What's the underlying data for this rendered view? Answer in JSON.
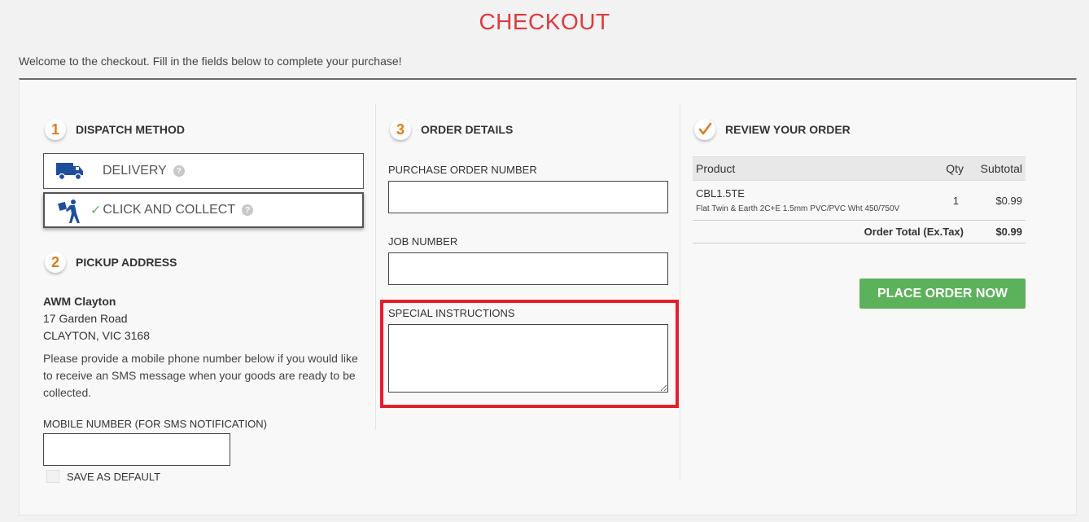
{
  "header": {
    "title": "CHECKOUT",
    "welcome": "Welcome to the checkout. Fill in the fields below to complete your purchase!"
  },
  "dispatch": {
    "step_number": "1",
    "title": "DISPATCH METHOD",
    "options": [
      {
        "label": "DELIVERY",
        "icon": "truck-icon",
        "selected": false
      },
      {
        "label": "CLICK AND COLLECT",
        "icon": "person-carrying-box-icon",
        "selected": true
      }
    ]
  },
  "pickup": {
    "step_number": "2",
    "title": "PICKUP ADDRESS",
    "name": "AWM Clayton",
    "street": "17 Garden Road",
    "city": "CLAYTON, VIC 3168",
    "sms_note": "Please provide a mobile phone number below if you would like to receive an SMS message when your goods are ready to be collected.",
    "mobile_label": "MOBILE NUMBER (FOR SMS NOTIFICATION)",
    "mobile_value": "",
    "save_default_label": "SAVE AS DEFAULT"
  },
  "order_details": {
    "step_number": "3",
    "title": "ORDER DETAILS",
    "po_label": "PURCHASE ORDER NUMBER",
    "po_value": "",
    "job_label": "JOB NUMBER",
    "job_value": "",
    "instructions_label": "SPECIAL INSTRUCTIONS",
    "instructions_value": ""
  },
  "review": {
    "title": "REVIEW YOUR ORDER",
    "headers": {
      "product": "Product",
      "qty": "Qty",
      "subtotal": "Subtotal"
    },
    "items": [
      {
        "code": "CBL1.5TE",
        "description": "Flat Twin & Earth 2C+E 1.5mm PVC/PVC Wht 450/750V",
        "qty": "1",
        "subtotal": "$0.99"
      }
    ],
    "total_label": "Order Total (Ex.Tax)",
    "total_value": "$0.99",
    "place_order_label": "PLACE ORDER NOW"
  },
  "colors": {
    "title_red": "#e0393e",
    "step_orange": "#e07b1b",
    "button_green": "#5cb25a",
    "highlight_red": "#e41e2b"
  }
}
